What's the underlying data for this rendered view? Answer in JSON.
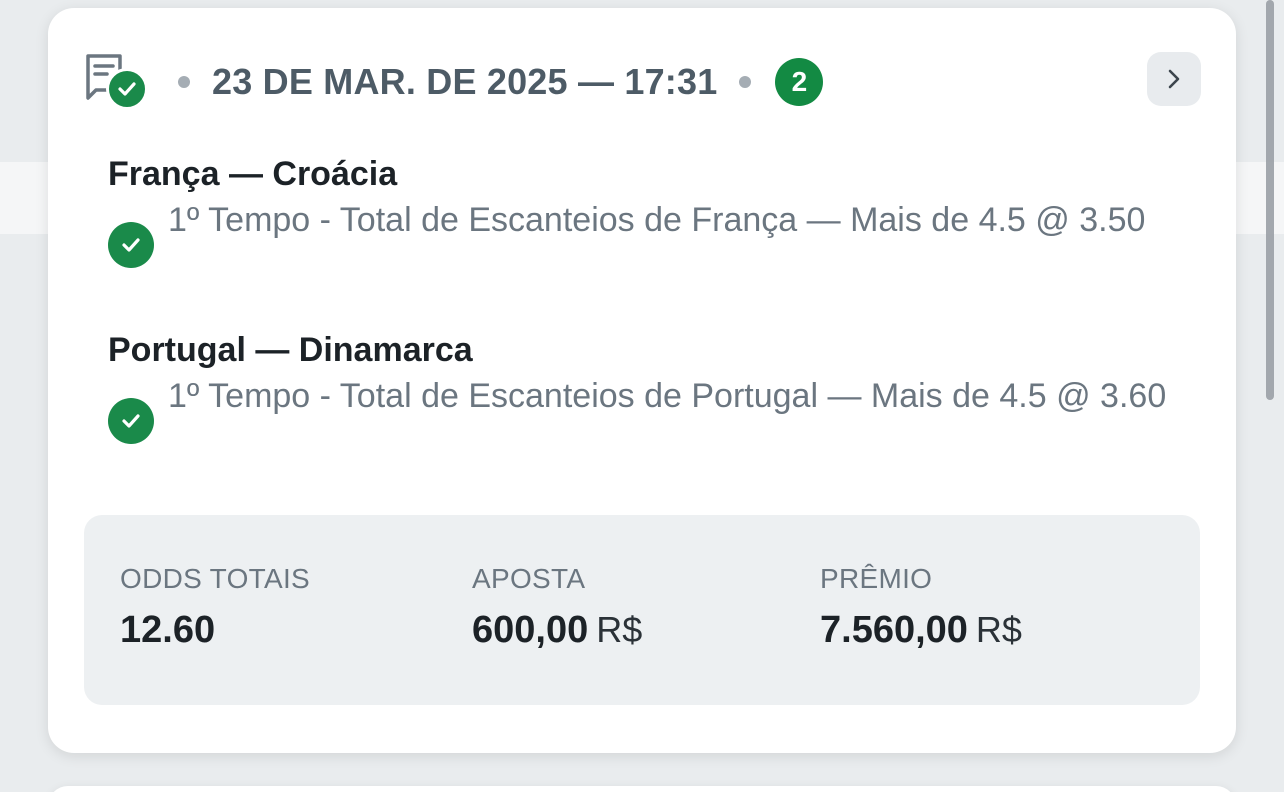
{
  "header": {
    "date_time": "23 DE MAR. DE 2025 — 17:31",
    "selection_count": "2"
  },
  "selections": [
    {
      "match": "França — Croácia",
      "market": "1º Tempo - Total de Escanteios de França — Mais de 4.5 @ 3.50"
    },
    {
      "match": "Portugal — Dinamarca",
      "market": "1º Tempo - Total de Escanteios de Portugal — Mais de 4.5 @ 3.60"
    }
  ],
  "summary": {
    "odds_label": "ODDS TOTAIS",
    "odds_value": "12.60",
    "stake_label": "APOSTA",
    "stake_value": "600,00",
    "stake_currency": "R$",
    "prize_label": "PRÊMIO",
    "prize_value": "7.560,00",
    "prize_currency": "R$"
  },
  "colors": {
    "success_green": "#1a8a4a",
    "badge_green": "#138a43",
    "muted_text": "#6b7680",
    "header_text": "#4d5b66"
  },
  "icons": {
    "ticket": "receipt-check-icon",
    "expand": "chevron-right-icon",
    "won": "check-circle-icon"
  }
}
